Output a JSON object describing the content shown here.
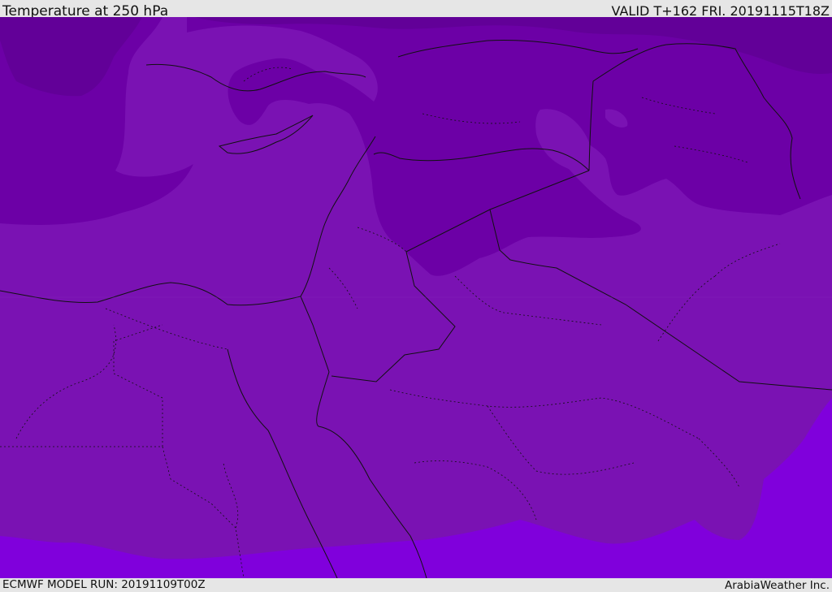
{
  "header": {
    "title": "Temperature at 250 hPa",
    "valid_time": "VALID T+162 FRI. 20191115T18Z"
  },
  "footer": {
    "model_run": "ECMWF MODEL RUN: 20191109T00Z",
    "credit": "ArabiaWeather Inc."
  },
  "map": {
    "variable": "Temperature",
    "level": "250 hPa",
    "colors": {
      "coldest": "#620098",
      "cold": "#6c00a6",
      "mid": "#7a12b3",
      "warm": "#8000dc",
      "border": "#111111"
    }
  }
}
